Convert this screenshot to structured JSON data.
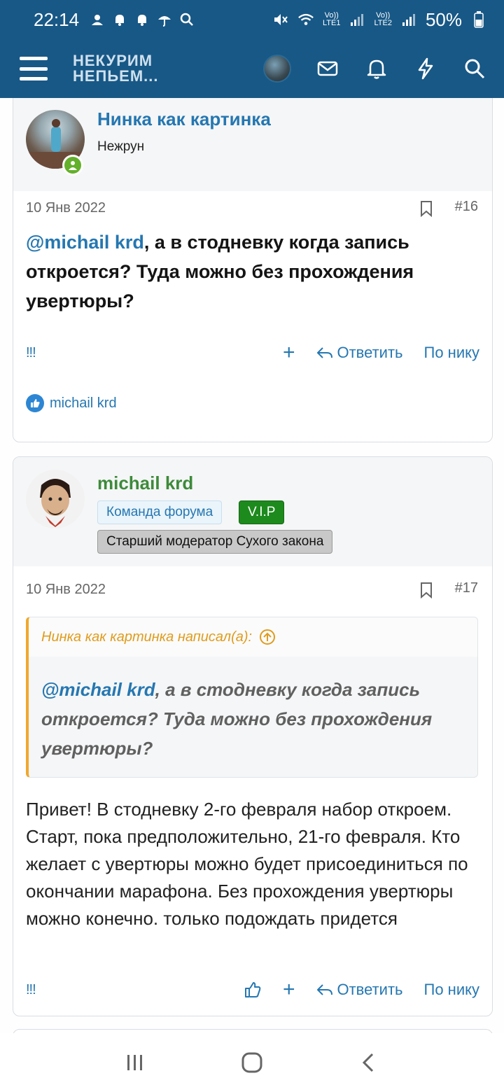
{
  "status": {
    "time": "22:14",
    "battery": "50%",
    "net1": "LTE1",
    "net2": "LTE2"
  },
  "nav": {
    "logo_line1": "НЕКУРИМ",
    "logo_line2": "НЕПЬЕМ..."
  },
  "posts": [
    {
      "author": "Нинка как картинка",
      "title": "Нежрун",
      "date": "10 Янв 2022",
      "number": "#16",
      "mention": "@michail krd",
      "text": ", а в стодневку когда запись откроется? Туда можно без прохождения увертюры?",
      "report": "!!!",
      "reply": "Ответить",
      "by_nick": "По нику",
      "reaction_user": "michail krd"
    },
    {
      "author": "michail krd",
      "badge_team": "Команда форума",
      "badge_vip": "V.I.P",
      "badge_role": "Старший модератор Сухого закона",
      "date": "10 Янв 2022",
      "number": "#17",
      "quote_author": "Нинка как картинка написал(а):",
      "quote_mention": "@michail krd",
      "quote_text": ", а в стодневку когда запись откроется? Туда можно без прохождения увертюры?",
      "text": "Привет! В стодневку 2-го февраля набор откроем. Старт, пока предположительно, 21-го февраля. Кто желает с увертюры можно будет присоединиться по окончании марафона. Без прохождения увертюры можно конечно. только подождать придется",
      "report": "!!!",
      "reply": "Ответить",
      "by_nick": "По нику"
    }
  ],
  "colors": {
    "header": "#185886",
    "link": "#2577b1",
    "author2": "#3d8a3a",
    "quote_accent": "#f0a82c",
    "vip": "#1d8a1d"
  }
}
